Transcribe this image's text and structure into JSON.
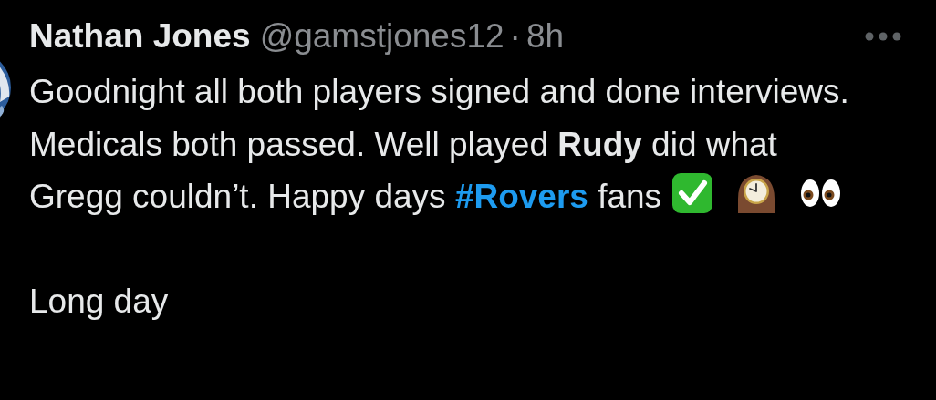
{
  "tweet": {
    "author": {
      "name": "Nathan Jones",
      "handle": "@gamstjones12",
      "separator": "·",
      "time": "8h"
    },
    "body": {
      "text": "Goodnight all both players signed and done interviews. Medicals both passed. Well played **Rudy** did what Gregg couldn’t. Happy days",
      "hashtag": "#Rovers",
      "after_hashtag": "fans"
    },
    "second_paragraph": "Long day"
  }
}
